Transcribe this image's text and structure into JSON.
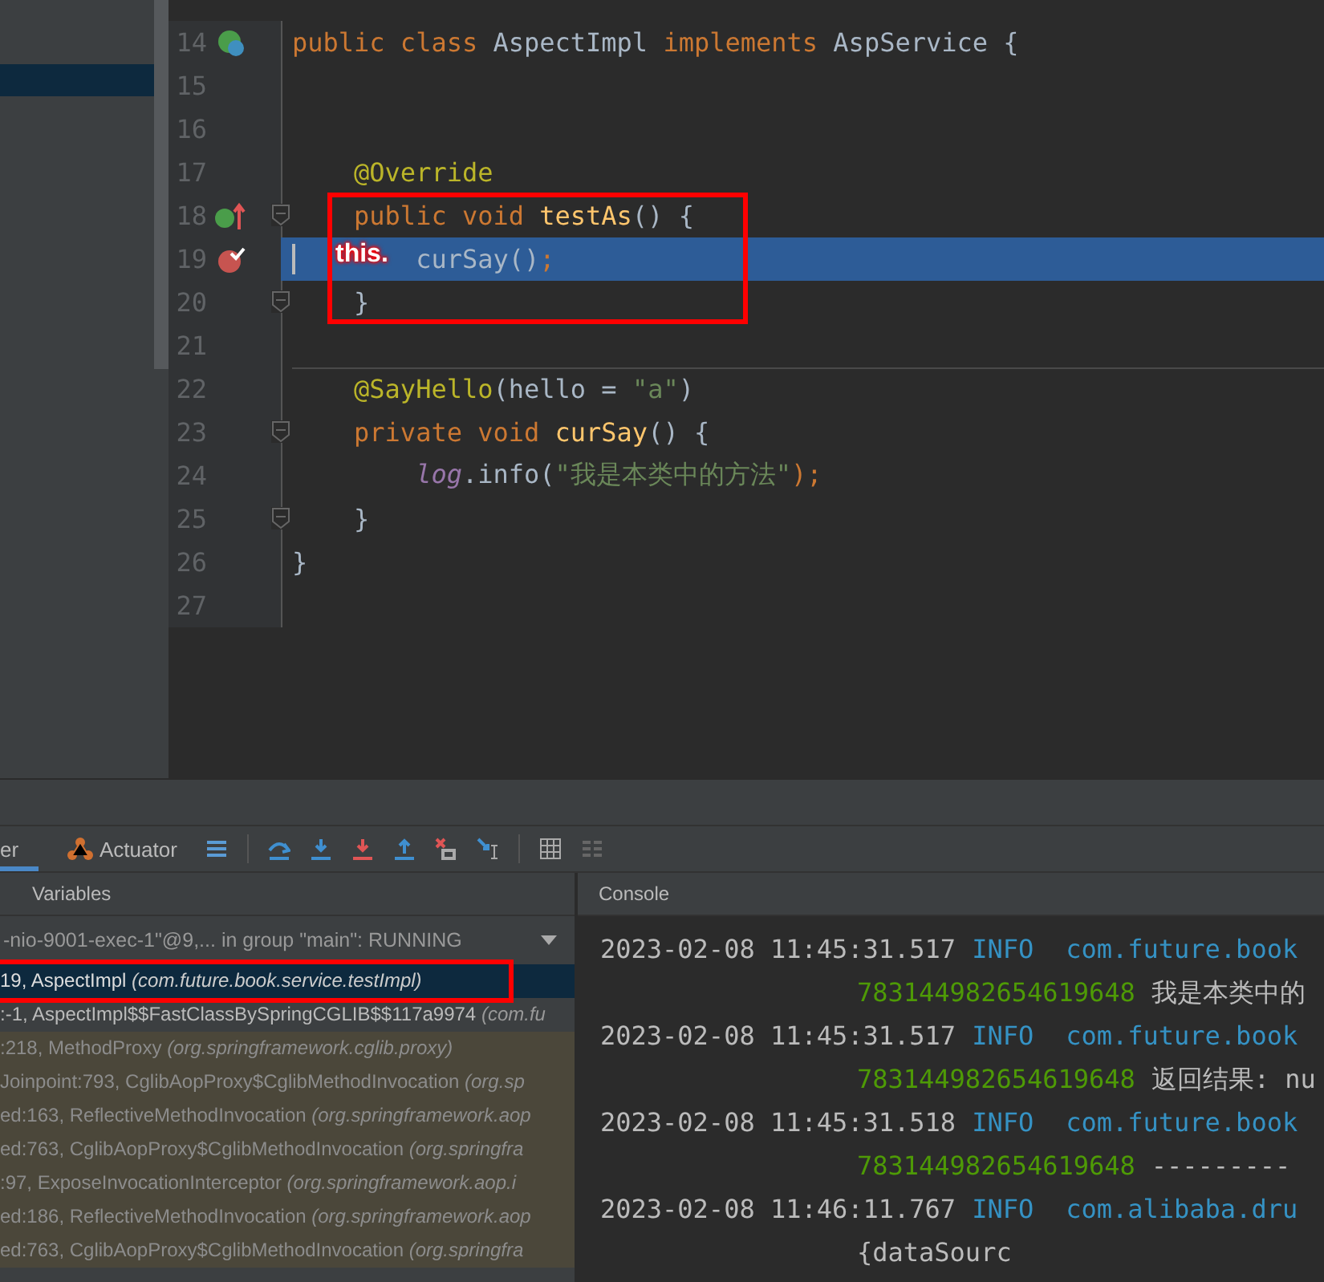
{
  "editor": {
    "lines": [
      {
        "number": "14",
        "kind": "bean",
        "tokens": [
          {
            "text": "public class ",
            "kind": "kw"
          },
          {
            "text": "AspectImpl ",
            "kind": "plain"
          },
          {
            "text": "implements ",
            "kind": "kw"
          },
          {
            "text": "AspService {",
            "kind": "plain"
          }
        ]
      },
      {
        "number": "15",
        "kind": "plain"
      },
      {
        "number": "16",
        "kind": "plain"
      },
      {
        "number": "17",
        "kind": "plain",
        "tokens": [
          {
            "text": "    @Override",
            "kind": "annotation"
          }
        ]
      },
      {
        "number": "18",
        "kind": "implements",
        "fold": true,
        "tokens": [
          {
            "text": "    public void ",
            "kind": "kw"
          },
          {
            "text": "testAs",
            "kind": "method"
          },
          {
            "text": "() {",
            "kind": "plain"
          }
        ]
      },
      {
        "number": "19",
        "kind": "breakpoint",
        "current": true,
        "hint": "this.",
        "tokens": [
          {
            "text": "        curSay()",
            "kind": "plain"
          },
          {
            "text": ";",
            "kind": "kw"
          }
        ]
      },
      {
        "number": "20",
        "kind": "plain",
        "fold": true,
        "tokens": [
          {
            "text": "    }",
            "kind": "plain"
          }
        ]
      },
      {
        "number": "21",
        "kind": "plain"
      },
      {
        "number": "22",
        "kind": "plain",
        "separator": true,
        "tokens": [
          {
            "text": "    @SayHello",
            "kind": "annotation"
          },
          {
            "text": "(hello = ",
            "kind": "plain"
          },
          {
            "text": "\"a\"",
            "kind": "string"
          },
          {
            "text": ")",
            "kind": "plain"
          }
        ]
      },
      {
        "number": "23",
        "kind": "plain",
        "fold": true,
        "tokens": [
          {
            "text": "    private void ",
            "kind": "kw"
          },
          {
            "text": "curSay",
            "kind": "method"
          },
          {
            "text": "() {",
            "kind": "plain"
          }
        ]
      },
      {
        "number": "24",
        "kind": "plain",
        "tokens": [
          {
            "text": "        log",
            "kind": "field"
          },
          {
            "text": ".info(",
            "kind": "plain"
          },
          {
            "text": "\"我是本类中的方法\"",
            "kind": "string"
          },
          {
            "text": ");",
            "kind": "kw"
          }
        ]
      },
      {
        "number": "25",
        "kind": "plain",
        "fold": true,
        "tokens": [
          {
            "text": "    }",
            "kind": "plain"
          }
        ]
      },
      {
        "number": "26",
        "kind": "plain",
        "tokens": [
          {
            "text": "}",
            "kind": "plain"
          }
        ]
      },
      {
        "number": "27",
        "kind": "plain"
      }
    ]
  },
  "debug_tabs": [
    {
      "label": "er",
      "selected": true
    },
    {
      "label": "Actuator",
      "selected": false
    }
  ],
  "frames": {
    "header": "Variables",
    "thread": "-nio-9001-exec-1\"@9,... in group \"main\": RUNNING",
    "items": [
      {
        "text": "19, AspectImpl",
        "package": "(com.future.book.service.testImpl)",
        "kind": "user",
        "selected": true
      },
      {
        "text": ":-1, AspectImpl$$FastClassBySpringCGLIB$$117a9974",
        "package": "(com.fu",
        "kind": "user",
        "selected": false
      },
      {
        "text": ":218, MethodProxy",
        "package": "(org.springframework.cglib.proxy)",
        "kind": "library",
        "selected": false
      },
      {
        "text": "Joinpoint:793, CglibAopProxy$CglibMethodInvocation",
        "package": "(org.sp",
        "kind": "library",
        "selected": false
      },
      {
        "text": "ed:163, ReflectiveMethodInvocation",
        "package": "(org.springframework.aop",
        "kind": "library",
        "selected": false
      },
      {
        "text": "ed:763, CglibAopProxy$CglibMethodInvocation",
        "package": "(org.springfra",
        "kind": "library",
        "selected": false
      },
      {
        "text": ":97, ExposeInvocationInterceptor",
        "package": "(org.springframework.aop.i",
        "kind": "library",
        "selected": false
      },
      {
        "text": "ed:186, ReflectiveMethodInvocation",
        "package": "(org.springframework.aop",
        "kind": "library",
        "selected": false
      },
      {
        "text": "ed:763, CglibAopProxy$CglibMethodInvocation",
        "package": "(org.springfra",
        "kind": "library",
        "selected": false
      }
    ]
  },
  "console": {
    "header": "Console",
    "entries": [
      {
        "time": "2023-02-08 11:45:31.517",
        "level": "INFO",
        "logger": "com.future.book",
        "id": "783144982654619648",
        "message": "我是本类中的"
      },
      {
        "time": "2023-02-08 11:45:31.517",
        "level": "INFO",
        "logger": "com.future.book",
        "id": "783144982654619648",
        "message": "返回结果: nu"
      },
      {
        "time": "2023-02-08 11:45:31.518",
        "level": "INFO",
        "logger": "com.future.book",
        "id": "783144982654619648",
        "message": "---------"
      },
      {
        "time": "2023-02-08 11:46:11.767",
        "level": "INFO",
        "logger": "com.alibaba.dru",
        "message": "{dataSourc"
      }
    ]
  }
}
